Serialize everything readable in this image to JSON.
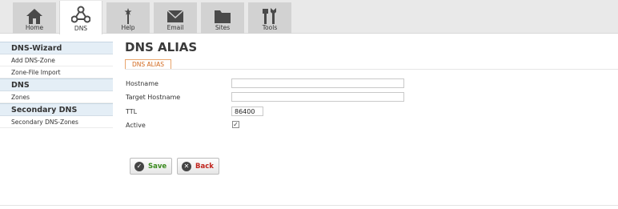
{
  "nav": {
    "tabs": [
      {
        "label": "Home",
        "icon": "home-icon"
      },
      {
        "label": "DNS",
        "icon": "network-icon"
      },
      {
        "label": "Help",
        "icon": "magic-wand-icon"
      },
      {
        "label": "Email",
        "icon": "envelope-icon"
      },
      {
        "label": "Sites",
        "icon": "folder-icon"
      },
      {
        "label": "Tools",
        "icon": "tools-icon"
      }
    ],
    "active": "DNS"
  },
  "sidebar": {
    "groups": [
      {
        "title": "DNS-Wizard",
        "items": [
          "Add DNS-Zone",
          "Zone-File Import"
        ]
      },
      {
        "title": "DNS",
        "items": [
          "Zones"
        ]
      },
      {
        "title": "Secondary DNS",
        "items": [
          "Secondary DNS-Zones"
        ]
      }
    ]
  },
  "main": {
    "title": "DNS ALIAS",
    "subtab": "DNS ALIAS",
    "fields": {
      "hostname": {
        "label": "Hostname",
        "value": ""
      },
      "target": {
        "label": "Target Hostname",
        "value": ""
      },
      "ttl": {
        "label": "TTL",
        "value": "86400"
      },
      "active": {
        "label": "Active",
        "checked": true
      }
    },
    "buttons": {
      "save": "Save",
      "back": "Back"
    }
  },
  "colors": {
    "accent": "#d2691e",
    "sidebar_header_bg": "#e4eef6",
    "save_text": "#3a8a1e",
    "back_text": "#c0221b"
  }
}
